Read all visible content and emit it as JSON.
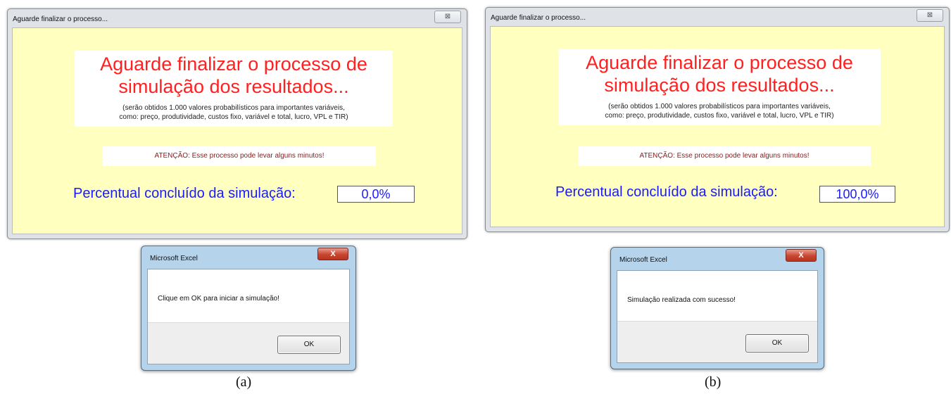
{
  "panels": [
    {
      "caption": "(a)",
      "form": {
        "title": "Aguarde finalizar o processo...",
        "close_label": "⊠",
        "main_message_line1": "Aguarde finalizar o processo de",
        "main_message_line2": "simulação dos resultados...",
        "sub_message_line1": "(serão obtidos 1.000 valores probabilísticos para importantes variáveis,",
        "sub_message_line2": "como: preço, produtividade, custos fixo, variável e total, lucro, VPL e TIR)",
        "warning": "ATENÇÃO: Esse processo pode levar alguns minutos!",
        "progress_label": "Percentual concluído da simulação:",
        "progress_value": "0,0%"
      },
      "msgbox": {
        "title": "Microsoft Excel",
        "close_label": "X",
        "message": "Clique em OK para iniciar a simulação!",
        "ok_label": "OK"
      }
    },
    {
      "caption": "(b)",
      "form": {
        "title": "Aguarde finalizar o processo...",
        "close_label": "⊠",
        "main_message_line1": "Aguarde finalizar o processo de",
        "main_message_line2": "simulação dos resultados...",
        "sub_message_line1": "(serão obtidos 1.000 valores probabilísticos para importantes variáveis,",
        "sub_message_line2": "como: preço, produtividade, custos fixo, variável e total, lucro, VPL e TIR)",
        "warning": "ATENÇÃO: Esse processo pode levar alguns minutos!",
        "progress_label": "Percentual concluído da simulação:",
        "progress_value": "100,0%"
      },
      "msgbox": {
        "title": "Microsoft Excel",
        "close_label": "X",
        "message": "Simulação realizada com sucesso!",
        "ok_label": "OK"
      }
    }
  ],
  "colors": {
    "form_background": "#ffffc0",
    "main_message": "#ff2020",
    "progress_text": "#1a1aff",
    "warning_text": "#8b1a1a",
    "msgbox_frame": "#b5d3ea",
    "close_button_red": "#c8452f"
  }
}
